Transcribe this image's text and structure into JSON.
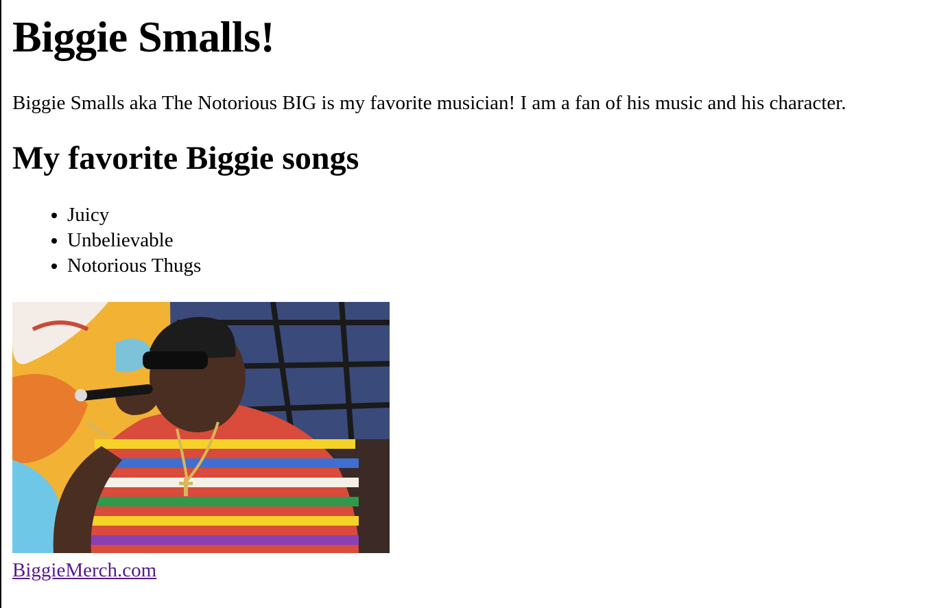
{
  "page": {
    "title": "Biggie Smalls!",
    "intro": "Biggie Smalls aka The Notorious BIG is my favorite musician! I am a fan of his music and his character.",
    "songs_heading": "My favorite Biggie songs",
    "songs": [
      "Juicy",
      "Unbelievable",
      "Notorious Thugs"
    ],
    "photo_icon": "photo-of-biggie-smalls-performing",
    "link_text": "BiggieMerch.com",
    "link_color": "#551A8B"
  }
}
